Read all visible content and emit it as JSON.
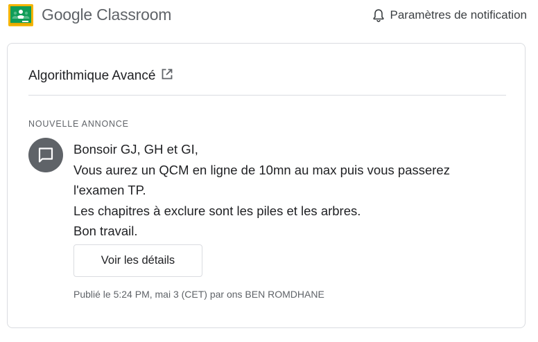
{
  "header": {
    "brand": "Google Classroom",
    "notification_settings": "Paramètres de notification",
    "icons": [
      "google-classroom-logo",
      "bell-icon"
    ]
  },
  "card": {
    "course_name": "Algorithmique Avancé",
    "section_label": "NOUVELLE ANNONCE",
    "message_lines": [
      "Bonsoir GJ, GH et GI,",
      "Vous aurez un QCM en ligne de 10mn au max puis vous passerez",
      "l'examen TP.",
      "Les chapitres à exclure sont les piles et les arbres.",
      "Bon travail."
    ],
    "details_button": "Voir les détails",
    "posted_info": "Publié le 5:24 PM, mai 3 (CET) par ons BEN ROMDHANE",
    "icons": [
      "open-in-new-icon",
      "announcement-icon"
    ]
  },
  "colors": {
    "logo_yellow": "#f4b400",
    "logo_green": "#0f9d58",
    "text_primary": "#202124",
    "text_secondary": "#5f6368",
    "border": "#dadce0",
    "avatar_bg": "#5f6368"
  }
}
